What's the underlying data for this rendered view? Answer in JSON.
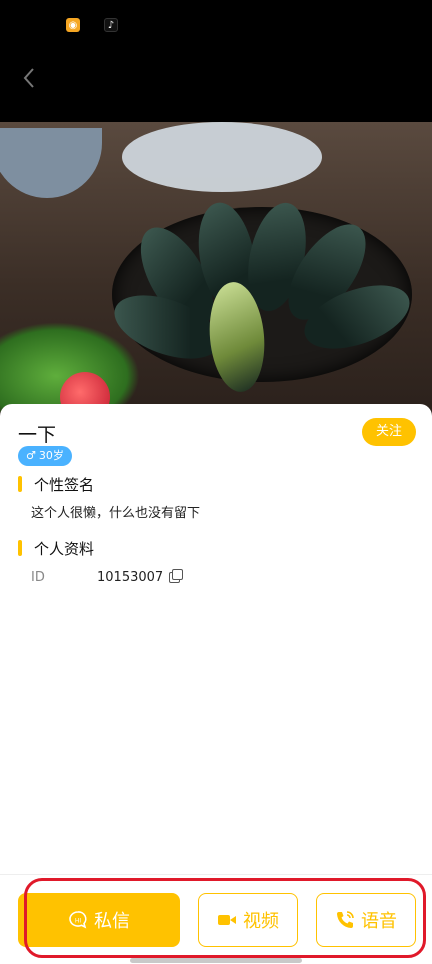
{
  "header": {
    "status_icons": [
      "weibo-icon",
      "tiktok-icon"
    ],
    "back_icon": "back-icon"
  },
  "profile": {
    "name": "一下",
    "gender_symbol": "♂",
    "age": "30岁",
    "follow_label": "关注"
  },
  "sections": {
    "signature_title": "个性签名",
    "signature_text": "这个人很懒，什么也没有留下",
    "profile_title": "个人资料",
    "id_label": "ID",
    "id_value": "10153007"
  },
  "actions": {
    "message_label": "私信",
    "video_label": "视频",
    "voice_label": "语音"
  },
  "colors": {
    "accent": "#ffc200",
    "badge": "#4ab2ff",
    "highlight": "#e0192a"
  }
}
